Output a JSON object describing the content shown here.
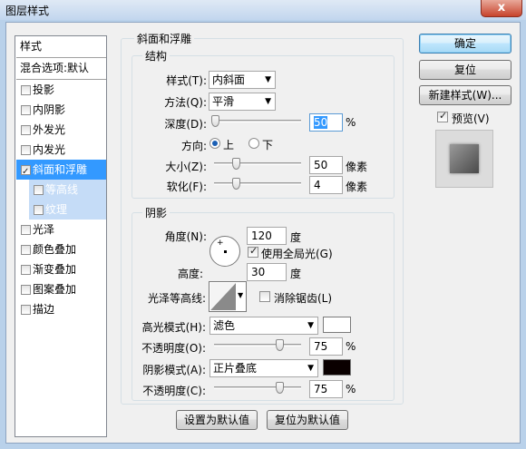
{
  "window": {
    "title": "图层样式",
    "close_glyph": "x"
  },
  "left_panel": {
    "header": "样式",
    "blend_options": "混合选项:默认",
    "items": [
      {
        "label": "投影",
        "checked": false
      },
      {
        "label": "内阴影",
        "checked": false
      },
      {
        "label": "外发光",
        "checked": false
      },
      {
        "label": "内发光",
        "checked": false
      },
      {
        "label": "斜面和浮雕",
        "checked": true,
        "selected": true
      },
      {
        "label": "等高线",
        "checked": false,
        "sub": true
      },
      {
        "label": "纹理",
        "checked": false,
        "sub": true
      },
      {
        "label": "光泽",
        "checked": false
      },
      {
        "label": "颜色叠加",
        "checked": false
      },
      {
        "label": "渐变叠加",
        "checked": false
      },
      {
        "label": "图案叠加",
        "checked": false
      },
      {
        "label": "描边",
        "checked": false
      }
    ]
  },
  "bevel": {
    "title": "斜面和浮雕",
    "structure": {
      "title": "结构",
      "style_label": "样式(T):",
      "style_value": "内斜面",
      "technique_label": "方法(Q):",
      "technique_value": "平滑",
      "depth_label": "深度(D):",
      "depth_value": "50",
      "depth_unit": "%",
      "direction_label": "方向:",
      "direction_up": "上",
      "direction_down": "下",
      "size_label": "大小(Z):",
      "size_value": "50",
      "size_unit": "像素",
      "soften_label": "软化(F):",
      "soften_value": "4",
      "soften_unit": "像素"
    },
    "shading": {
      "title": "阴影",
      "angle_label": "角度(N):",
      "angle_value": "120",
      "angle_unit": "度",
      "global_light_label": "使用全局光(G)",
      "altitude_label": "高度:",
      "altitude_value": "30",
      "altitude_unit": "度",
      "gloss_contour_label": "光泽等高线:",
      "anti_aliased_label": "消除锯齿(L)",
      "highlight_mode_label": "高光模式(H):",
      "highlight_mode_value": "滤色",
      "highlight_color": "#ffffff",
      "highlight_opacity_label": "不透明度(O):",
      "highlight_opacity_value": "75",
      "highlight_opacity_unit": "%",
      "shadow_mode_label": "阴影模式(A):",
      "shadow_mode_value": "正片叠底",
      "shadow_color": "#0a0000",
      "shadow_opacity_label": "不透明度(C):",
      "shadow_opacity_value": "75",
      "shadow_opacity_unit": "%"
    },
    "make_default": "设置为默认值",
    "reset_default": "复位为默认值"
  },
  "right_panel": {
    "ok": "确定",
    "reset": "复位",
    "new_style": "新建样式(W)...",
    "preview_label": "预览(V)"
  },
  "icons": {
    "checkmark": "checkmark-icon",
    "dropdown": "chevron-down-icon",
    "contour": "contour-icon"
  }
}
